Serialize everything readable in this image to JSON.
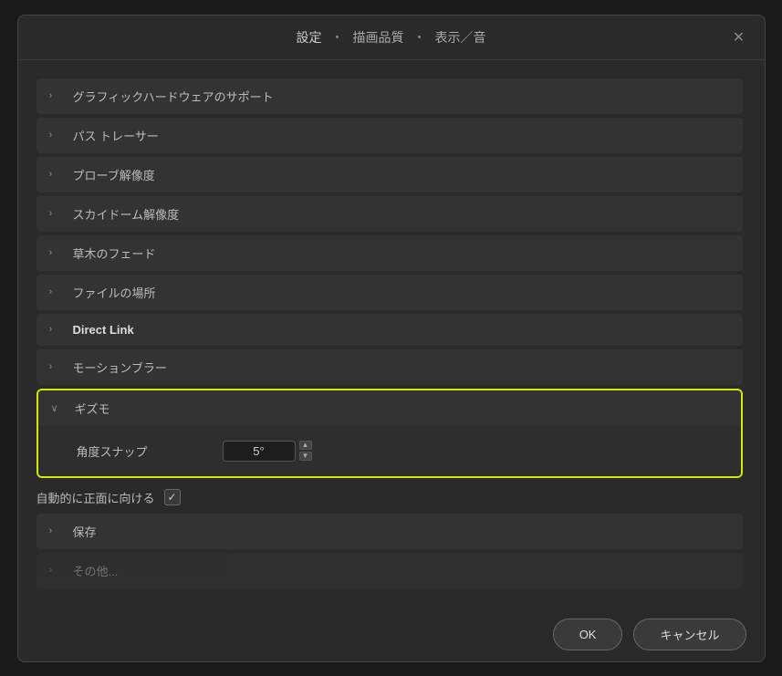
{
  "header": {
    "title": "設定",
    "sep1": "・",
    "nav1": "描画品質",
    "sep2": "・",
    "nav2": "表示／音",
    "close_label": "✕"
  },
  "sections": [
    {
      "id": "graphics-hardware",
      "label": "グラフィックハードウェアのサポート",
      "expanded": false,
      "bold": false
    },
    {
      "id": "path-tracer",
      "label": "パス トレーサー",
      "expanded": false,
      "bold": false
    },
    {
      "id": "probe-resolution",
      "label": "プローブ解像度",
      "expanded": false,
      "bold": false
    },
    {
      "id": "skydome-resolution",
      "label": "スカイドーム解像度",
      "expanded": false,
      "bold": false
    },
    {
      "id": "foliage-fade",
      "label": "草木のフェード",
      "expanded": false,
      "bold": false
    },
    {
      "id": "file-location",
      "label": "ファイルの場所",
      "expanded": false,
      "bold": false
    },
    {
      "id": "direct-link",
      "label": "Direct Link",
      "expanded": false,
      "bold": true
    },
    {
      "id": "motion-blur",
      "label": "モーションブラー",
      "expanded": false,
      "bold": false
    },
    {
      "id": "gizmo",
      "label": "ギズモ",
      "expanded": true,
      "bold": false
    }
  ],
  "gizmo_sub": {
    "angle_snap_label": "角度スナップ",
    "angle_snap_value": "5°"
  },
  "check_row": {
    "label": "自動的に正面に向ける",
    "checked": true
  },
  "sections_after": [
    {
      "id": "save",
      "label": "保存",
      "expanded": false,
      "bold": false
    },
    {
      "id": "more",
      "label": "その他...",
      "expanded": false,
      "bold": false
    }
  ],
  "footer": {
    "ok_label": "OK",
    "cancel_label": "キャンセル"
  }
}
